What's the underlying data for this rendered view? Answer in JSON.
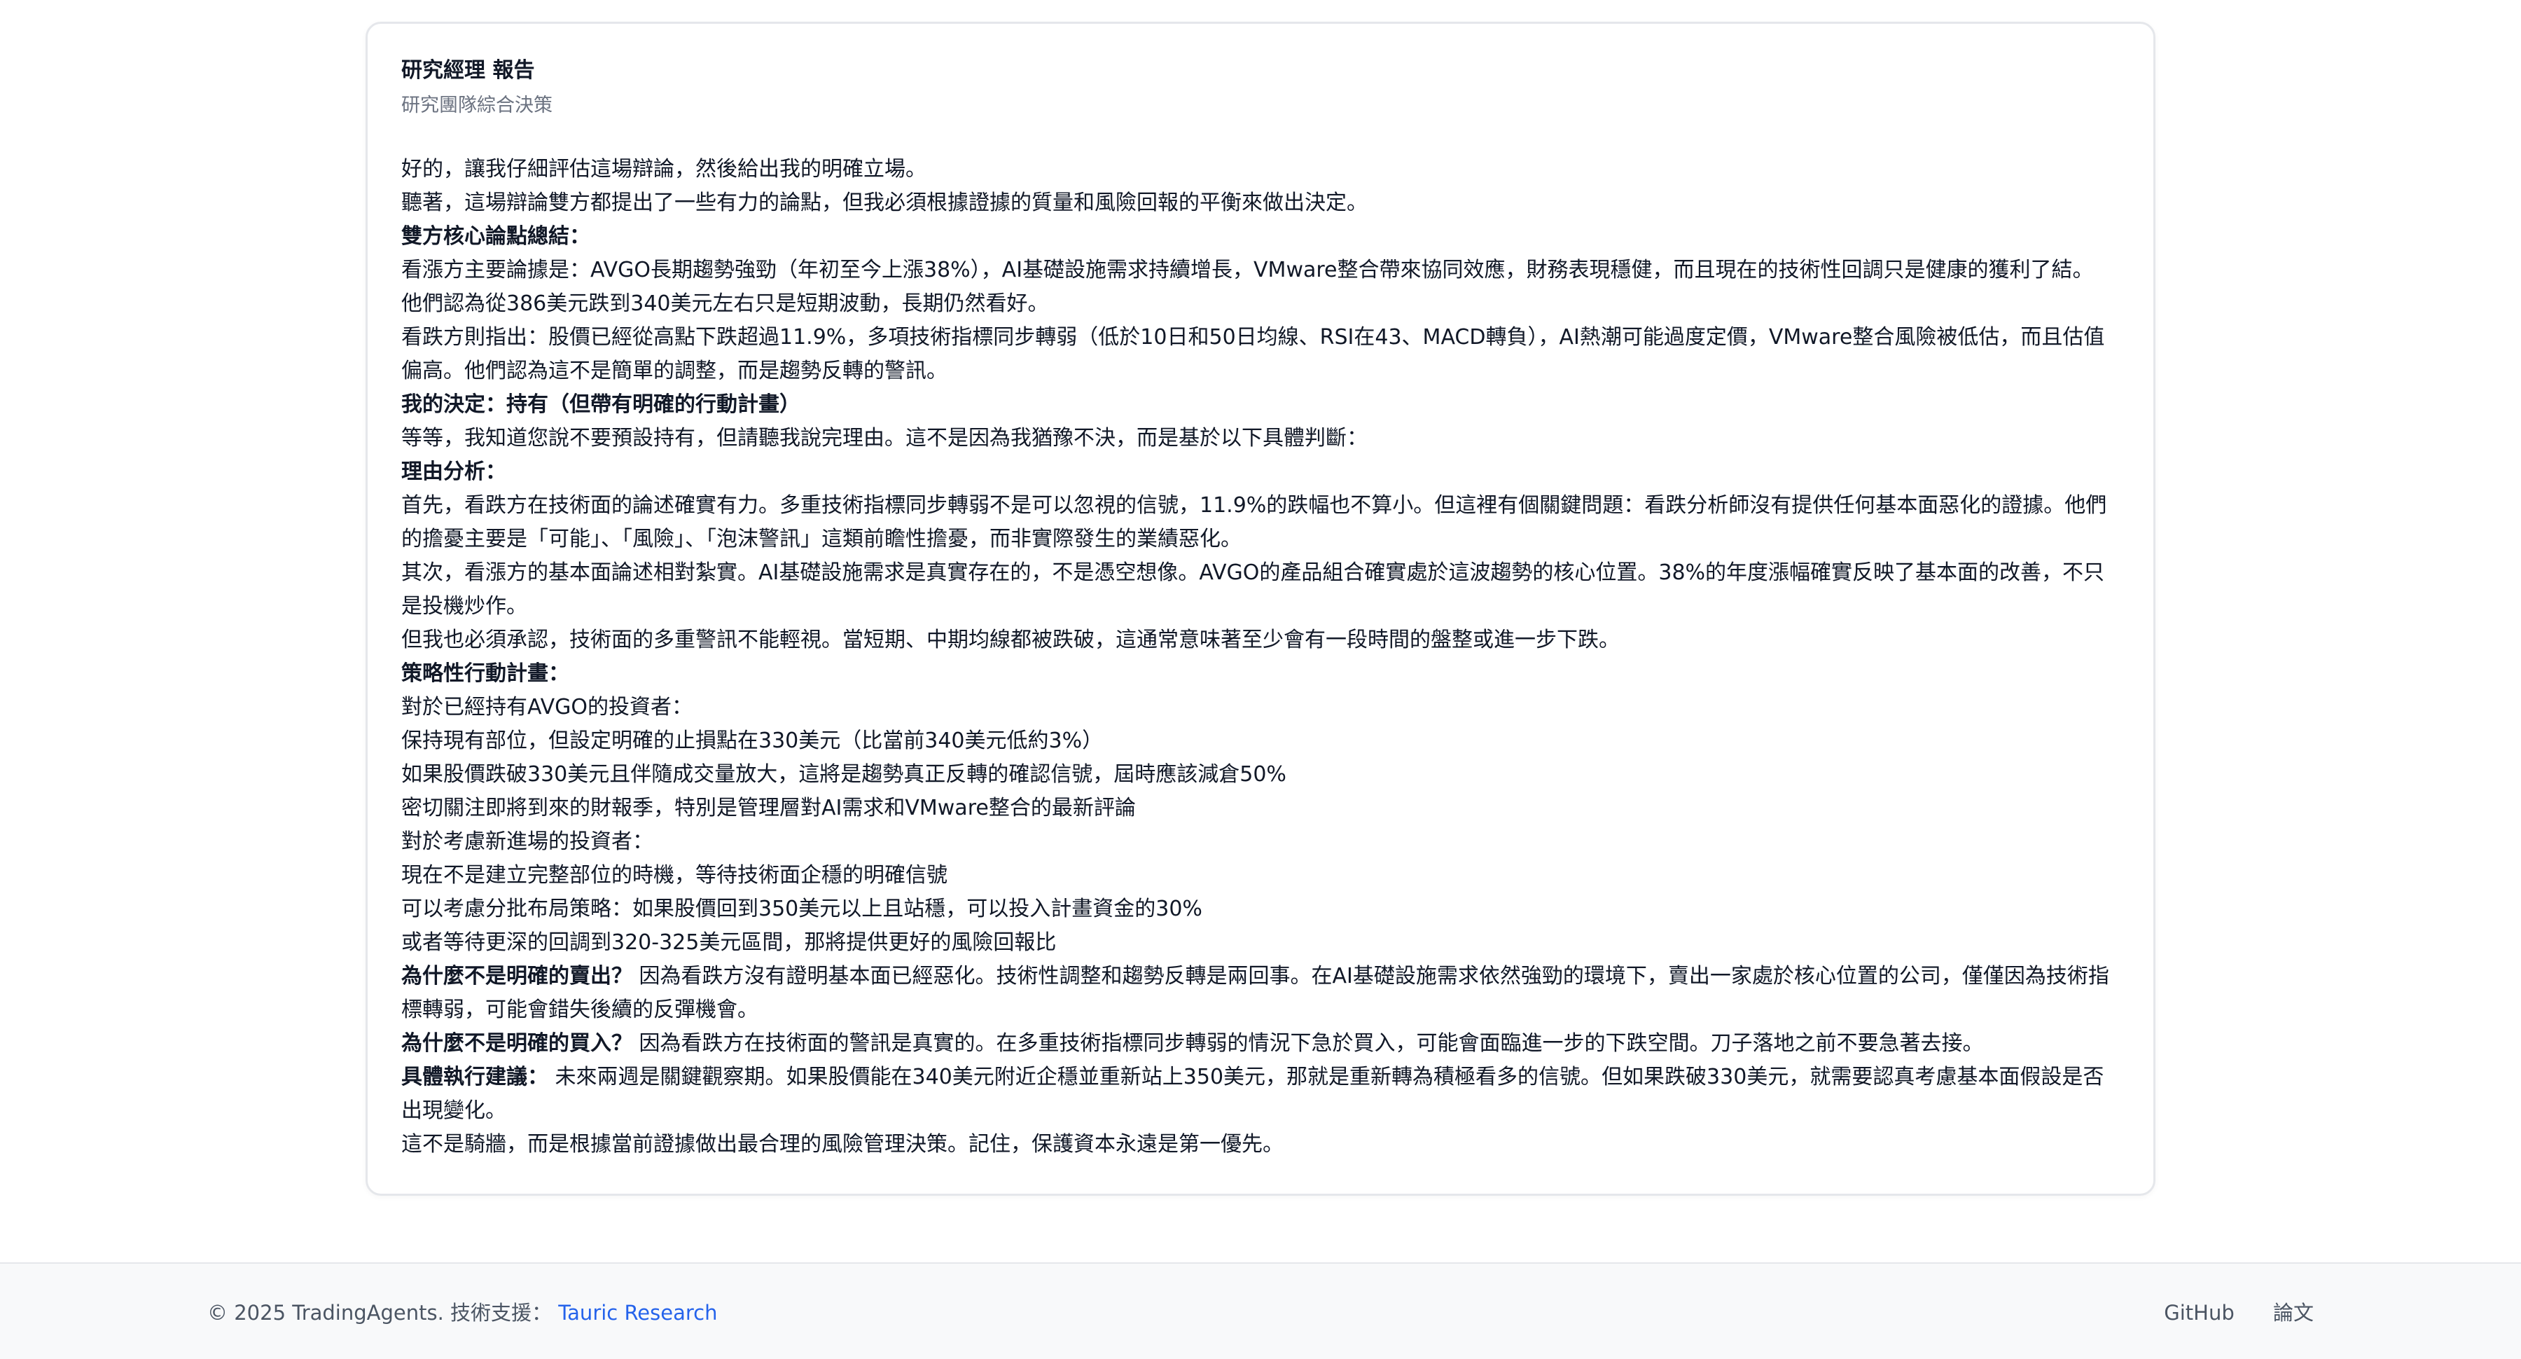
{
  "report": {
    "title": "研究經理 報告",
    "subtitle": "研究團隊綜合決策",
    "paragraphs": [
      {
        "text": "好的，讓我仔細評估這場辯論，然後給出我的明確立場。"
      },
      {
        "text": "聽著，這場辯論雙方都提出了一些有力的論點，但我必須根據證據的質量和風險回報的平衡來做出決定。"
      },
      {
        "lead": "雙方核心論點總結：",
        "text": ""
      },
      {
        "text": "看漲方主要論據是：AVGO長期趨勢強勁（年初至今上漲38%），AI基礎設施需求持續增長，VMware整合帶來協同效應，財務表現穩健，而且現在的技術性回調只是健康的獲利了結。他們認為從386美元跌到340美元左右只是短期波動，長期仍然看好。"
      },
      {
        "text": "看跌方則指出：股價已經從高點下跌超過11.9%，多項技術指標同步轉弱（低於10日和50日均線、RSI在43、MACD轉負），AI熱潮可能過度定價，VMware整合風險被低估，而且估值偏高。他們認為這不是簡單的調整，而是趨勢反轉的警訊。"
      },
      {
        "lead": "我的決定：持有（但帶有明確的行動計畫）",
        "text": ""
      },
      {
        "text": "等等，我知道您說不要預設持有，但請聽我說完理由。這不是因為我猶豫不決，而是基於以下具體判斷："
      },
      {
        "lead": "理由分析：",
        "text": ""
      },
      {
        "text": "首先，看跌方在技術面的論述確實有力。多重技術指標同步轉弱不是可以忽視的信號，11.9%的跌幅也不算小。但這裡有個關鍵問題：看跌分析師沒有提供任何基本面惡化的證據。他們的擔憂主要是「可能」、「風險」、「泡沫警訊」這類前瞻性擔憂，而非實際發生的業績惡化。"
      },
      {
        "text": "其次，看漲方的基本面論述相對紮實。AI基礎設施需求是真實存在的，不是憑空想像。AVGO的產品組合確實處於這波趨勢的核心位置。38%的年度漲幅確實反映了基本面的改善，不只是投機炒作。"
      },
      {
        "text": "但我也必須承認，技術面的多重警訊不能輕視。當短期、中期均線都被跌破，這通常意味著至少會有一段時間的盤整或進一步下跌。"
      },
      {
        "lead": "策略性行動計畫：",
        "text": ""
      },
      {
        "text": "對於已經持有AVGO的投資者："
      },
      {
        "text": "保持現有部位，但設定明確的止損點在330美元（比當前340美元低約3%）"
      },
      {
        "text": "如果股價跌破330美元且伴隨成交量放大，這將是趨勢真正反轉的確認信號，屆時應該減倉50%"
      },
      {
        "text": "密切關注即將到來的財報季，特別是管理層對AI需求和VMware整合的最新評論"
      },
      {
        "text": "對於考慮新進場的投資者："
      },
      {
        "text": "現在不是建立完整部位的時機，等待技術面企穩的明確信號"
      },
      {
        "text": "可以考慮分批布局策略：如果股價回到350美元以上且站穩，可以投入計畫資金的30%"
      },
      {
        "text": "或者等待更深的回調到320-325美元區間，那將提供更好的風險回報比"
      },
      {
        "lead": "為什麼不是明確的賣出？",
        "text": " 因為看跌方沒有證明基本面已經惡化。技術性調整和趨勢反轉是兩回事。在AI基礎設施需求依然強勁的環境下，賣出一家處於核心位置的公司，僅僅因為技術指標轉弱，可能會錯失後續的反彈機會。"
      },
      {
        "lead": "為什麼不是明確的買入？",
        "text": " 因為看跌方在技術面的警訊是真實的。在多重技術指標同步轉弱的情況下急於買入，可能會面臨進一步的下跌空間。刀子落地之前不要急著去接。"
      },
      {
        "lead": "具體執行建議：",
        "text": " 未來兩週是關鍵觀察期。如果股價能在340美元附近企穩並重新站上350美元，那就是重新轉為積極看多的信號。但如果跌破330美元，就需要認真考慮基本面假設是否出現變化。"
      },
      {
        "text": "這不是騎牆，而是根據當前證據做出最合理的風險管理決策。記住，保護資本永遠是第一優先。"
      }
    ]
  },
  "footer": {
    "copyright": "© 2025 TradingAgents. 技術支援：",
    "support_link": "Tauric Research",
    "links": [
      "GitHub",
      "論文"
    ]
  }
}
